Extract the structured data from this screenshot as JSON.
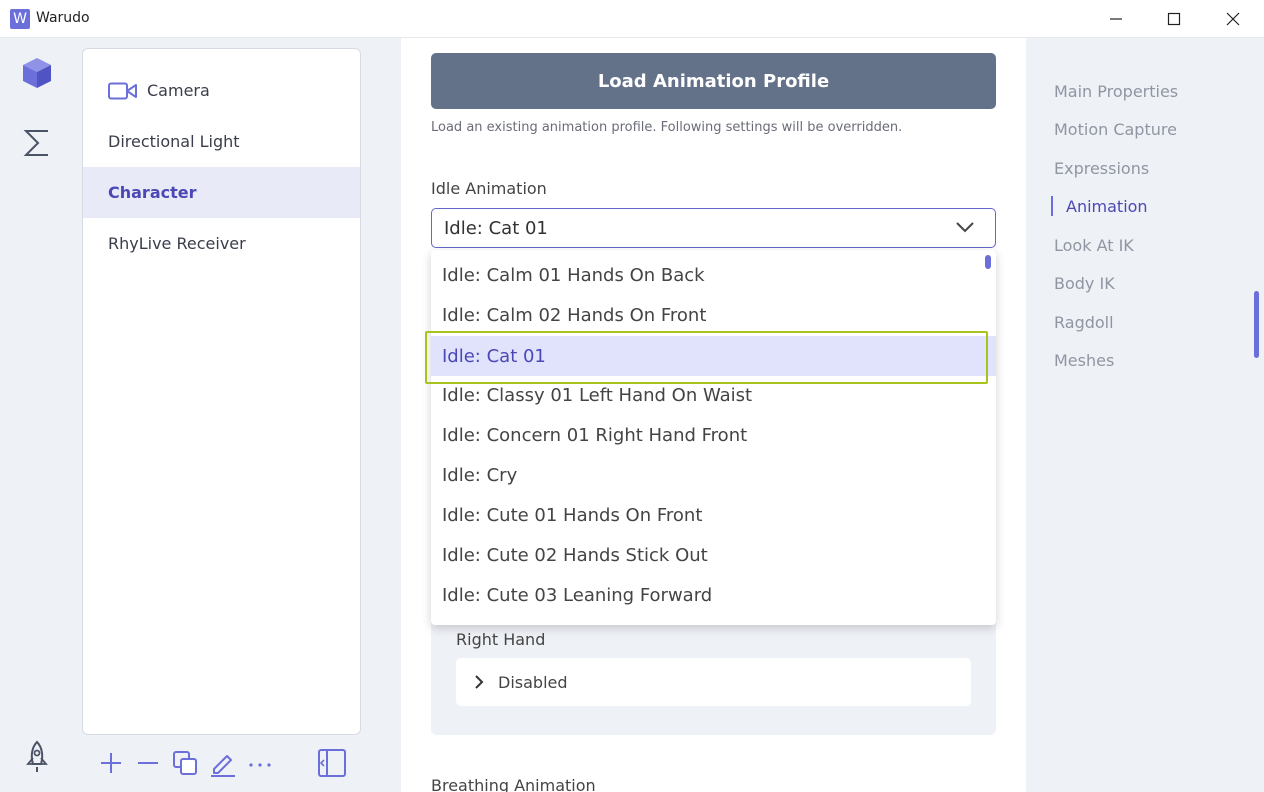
{
  "window": {
    "title": "Warudo",
    "logo_letter": "W"
  },
  "sidebar": {
    "items": [
      {
        "label": "Camera"
      },
      {
        "label": "Directional Light"
      },
      {
        "label": "Character"
      },
      {
        "label": "RhyLive Receiver"
      }
    ],
    "selected": "Character"
  },
  "main": {
    "load_button": "Load Animation Profile",
    "hint": "Load an existing animation profile. Following settings will be overridden.",
    "idle_label": "Idle Animation",
    "idle_value": "Idle: Cat 01",
    "right_hand_label": "Right Hand",
    "right_hand_value": "Disabled",
    "breathing_label": "Breathing Animation"
  },
  "dropdown": {
    "options": [
      "Idle: Calm 01 Hands On Back",
      "Idle: Calm 02 Hands On Front",
      "Idle: Cat 01",
      "Idle: Classy 01 Left Hand On Waist",
      "Idle: Concern 01 Right Hand Front",
      "Idle: Cry",
      "Idle: Cute 01 Hands On Front",
      "Idle: Cute 02 Hands Stick Out",
      "Idle: Cute 03 Leaning Forward"
    ],
    "selected": "Idle: Cat 01"
  },
  "right_nav": {
    "items": [
      "Main Properties",
      "Motion Capture",
      "Expressions",
      "Animation",
      "Look At IK",
      "Body IK",
      "Ragdoll",
      "Meshes"
    ],
    "active": "Animation"
  },
  "colors": {
    "accent": "#6b6fd9",
    "selected_text": "#4b48b5",
    "button_bg": "#637189",
    "highlight_border": "#a6c41c",
    "panel_bg": "#eef1f6"
  }
}
